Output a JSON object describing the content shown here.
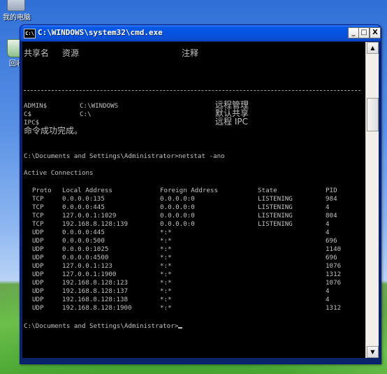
{
  "desktop": {
    "icons": [
      {
        "label": "我的电脑",
        "icon": "my-computer-icon"
      },
      {
        "label": "回收",
        "icon": "recycle-bin-icon"
      }
    ]
  },
  "window": {
    "title": "C:\\WINDOWS\\system32\\cmd.exe",
    "icon_text": "C:\\",
    "controls": {
      "minimize": "_",
      "maximize": "□",
      "close": "X"
    }
  },
  "console": {
    "share_header": {
      "name": "共享名",
      "resource": "资源",
      "remark": "注释"
    },
    "shares": [
      {
        "name": "ADMIN$",
        "resource": "C:\\WINDOWS",
        "remark": "远程管理"
      },
      {
        "name": "C$",
        "resource": "C:\\",
        "remark": "默认共享"
      },
      {
        "name": "IPC$",
        "resource": "",
        "remark": "远程 IPC"
      }
    ],
    "success_message": "命令成功完成。",
    "prompt1": "C:\\Documents and Settings\\Administrator>netstat -ano",
    "section_title": "Active Connections",
    "table_header": {
      "proto": "Proto",
      "local": "Local Address",
      "foreign": "Foreign Address",
      "state": "State",
      "pid": "PID"
    },
    "connections": [
      {
        "proto": "TCP",
        "local": "0.0.0.0:135",
        "foreign": "0.0.0.0:0",
        "state": "LISTENING",
        "pid": "984"
      },
      {
        "proto": "TCP",
        "local": "0.0.0.0:445",
        "foreign": "0.0.0.0:0",
        "state": "LISTENING",
        "pid": "4"
      },
      {
        "proto": "TCP",
        "local": "127.0.0.1:1029",
        "foreign": "0.0.0.0:0",
        "state": "LISTENING",
        "pid": "804"
      },
      {
        "proto": "TCP",
        "local": "192.168.8.128:139",
        "foreign": "0.0.0.0:0",
        "state": "LISTENING",
        "pid": "4"
      },
      {
        "proto": "UDP",
        "local": "0.0.0.0:445",
        "foreign": "*:*",
        "state": "",
        "pid": "4"
      },
      {
        "proto": "UDP",
        "local": "0.0.0.0:500",
        "foreign": "*:*",
        "state": "",
        "pid": "696"
      },
      {
        "proto": "UDP",
        "local": "0.0.0.0:1025",
        "foreign": "*:*",
        "state": "",
        "pid": "1140"
      },
      {
        "proto": "UDP",
        "local": "0.0.0.0:4500",
        "foreign": "*:*",
        "state": "",
        "pid": "696"
      },
      {
        "proto": "UDP",
        "local": "127.0.0.1:123",
        "foreign": "*:*",
        "state": "",
        "pid": "1076"
      },
      {
        "proto": "UDP",
        "local": "127.0.0.1:1900",
        "foreign": "*:*",
        "state": "",
        "pid": "1312"
      },
      {
        "proto": "UDP",
        "local": "192.168.8.128:123",
        "foreign": "*:*",
        "state": "",
        "pid": "1076"
      },
      {
        "proto": "UDP",
        "local": "192.168.8.128:137",
        "foreign": "*:*",
        "state": "",
        "pid": "4"
      },
      {
        "proto": "UDP",
        "local": "192.168.8.128:138",
        "foreign": "*:*",
        "state": "",
        "pid": "4"
      },
      {
        "proto": "UDP",
        "local": "192.168.8.128:1900",
        "foreign": "*:*",
        "state": "",
        "pid": "1312"
      }
    ],
    "prompt2": "C:\\Documents and Settings\\Administrator>"
  },
  "colors": {
    "console_bg": "#000000",
    "console_text": "#c0c0c0",
    "titlebar": "#0553e0"
  }
}
